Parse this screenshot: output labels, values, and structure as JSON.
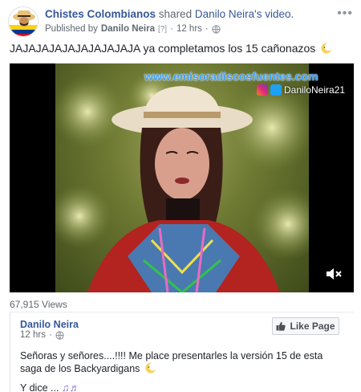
{
  "header": {
    "page_name": "Chistes Colombianos",
    "shared_word": "shared",
    "author_name": "Danilo Neira",
    "shared_suffix": "'s video.",
    "published_by_label": "Published by",
    "published_by_name": "Danilo Neira",
    "published_q": "[?]",
    "time": "12 hrs",
    "more_icon": "more-horizontal-icon"
  },
  "post": {
    "text": "JAJAJAJAJAJAJAJAJAJA ya completamos los 15 cañonazos"
  },
  "video": {
    "overlay_url": "www.emisoradiscosfuentes.com",
    "overlay_handle": "DaniloNeira21",
    "views": "67,915 Views"
  },
  "shared": {
    "name": "Danilo Neira",
    "time": "12 hrs",
    "like_label": "Like Page",
    "text": "Señoras y señores....!!!! Me place presentarles la versión 15 de esta saga de los Backyardigans",
    "text2": "Y dice ..."
  },
  "colors": {
    "link": "#365899",
    "muted": "#616770"
  }
}
